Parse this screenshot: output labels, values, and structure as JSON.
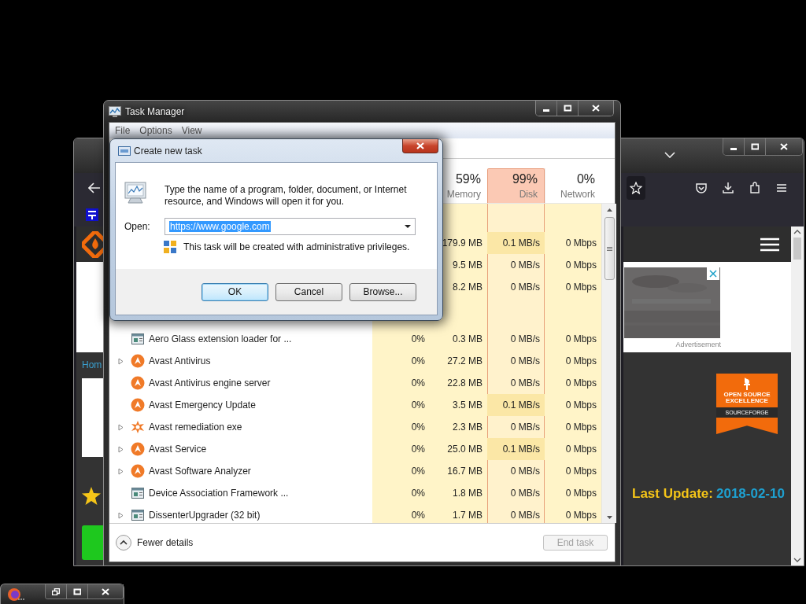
{
  "browser": {
    "home_link": "Hom",
    "advertisement_label": "Advertisement",
    "badge": {
      "title": "OPEN SOURCE EXCELLENCE",
      "brand": "SOURCEFORGE"
    },
    "last_update": {
      "label": "Last Update:",
      "date": "2018-02-10"
    }
  },
  "task_manager": {
    "title": "Task Manager",
    "menu": [
      "File",
      "Options",
      "View"
    ],
    "columns": [
      {
        "percent": "59%",
        "label": "Memory",
        "selected": false
      },
      {
        "percent": "99%",
        "label": "Disk",
        "selected": true
      },
      {
        "percent": "0%",
        "label": "Network",
        "selected": false
      }
    ],
    "partial_rows": [
      {
        "memory": "179.9 MB",
        "disk": "0.1 MB/s",
        "disk_busy": true,
        "network": "0 Mbps"
      },
      {
        "memory": "9.5 MB",
        "disk": "0 MB/s",
        "disk_busy": false,
        "network": "0 Mbps"
      },
      {
        "memory": "8.2 MB",
        "disk": "0 MB/s",
        "disk_busy": false,
        "network": "0 Mbps"
      }
    ],
    "rows": [
      {
        "name": "Aero Glass extension loader for ...",
        "kind": "app",
        "expandable": false,
        "cpu": "0%",
        "memory": "0.3 MB",
        "disk": "0 MB/s",
        "disk_busy": false,
        "network": "0 Mbps"
      },
      {
        "name": "Avast Antivirus",
        "kind": "avast",
        "expandable": true,
        "cpu": "0%",
        "memory": "27.2 MB",
        "disk": "0 MB/s",
        "disk_busy": false,
        "network": "0 Mbps"
      },
      {
        "name": "Avast Antivirus engine server",
        "kind": "avast",
        "expandable": false,
        "cpu": "0%",
        "memory": "22.8 MB",
        "disk": "0 MB/s",
        "disk_busy": false,
        "network": "0 Mbps"
      },
      {
        "name": "Avast Emergency Update",
        "kind": "avast",
        "expandable": false,
        "cpu": "0%",
        "memory": "3.5 MB",
        "disk": "0.1 MB/s",
        "disk_busy": true,
        "network": "0 Mbps"
      },
      {
        "name": "Avast remediation exe",
        "kind": "remediation",
        "expandable": true,
        "cpu": "0%",
        "memory": "2.3 MB",
        "disk": "0 MB/s",
        "disk_busy": false,
        "network": "0 Mbps"
      },
      {
        "name": "Avast Service",
        "kind": "avast",
        "expandable": true,
        "cpu": "0%",
        "memory": "25.0 MB",
        "disk": "0.1 MB/s",
        "disk_busy": true,
        "network": "0 Mbps"
      },
      {
        "name": "Avast Software Analyzer",
        "kind": "avast",
        "expandable": true,
        "cpu": "0%",
        "memory": "16.7 MB",
        "disk": "0 MB/s",
        "disk_busy": false,
        "network": "0 Mbps"
      },
      {
        "name": "Device Association Framework ...",
        "kind": "app",
        "expandable": false,
        "cpu": "0%",
        "memory": "1.8 MB",
        "disk": "0 MB/s",
        "disk_busy": false,
        "network": "0 Mbps"
      },
      {
        "name": "DissenterUpgrader (32 bit)",
        "kind": "app",
        "expandable": true,
        "cpu": "0%",
        "memory": "1.7 MB",
        "disk": "0 MB/s",
        "disk_busy": false,
        "network": "0 Mbps"
      }
    ],
    "fewer_details": "Fewer details",
    "end_task": {
      "label": "End task",
      "disabled": true
    }
  },
  "dialog": {
    "title": "Create new task",
    "message": "Type the name of a program, folder, document, or Internet resource, and Windows will open it for you.",
    "open_label": "Open:",
    "value": "https://www.google.com",
    "note": "This task will be created with administrative privileges.",
    "buttons": [
      {
        "label": "OK",
        "default": true
      },
      {
        "label": "Cancel",
        "default": false
      },
      {
        "label": "Browse...",
        "default": false
      }
    ]
  }
}
